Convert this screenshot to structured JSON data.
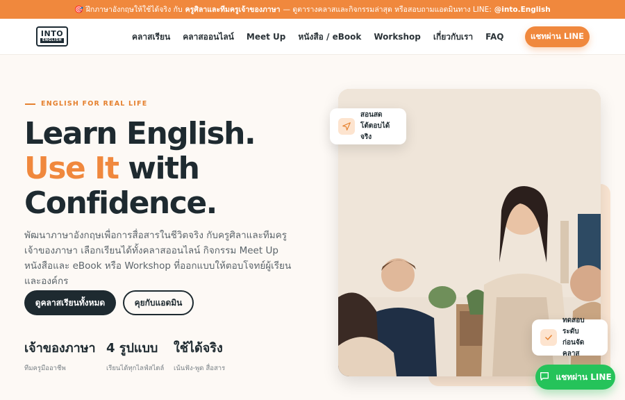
{
  "announcement": {
    "pre": "🎯 ฝึกภาษาอังกฤษให้ใช้ได้จริง กับ",
    "strong": "ครูศิลาและทีมครูเจ้าของภาษา",
    "mid": " — ดูตารางคลาสและกิจกรรมล่าสุด หรือสอบถามแอดมินทาง LINE:",
    "line_id": "@into.English"
  },
  "nav": {
    "logo_top": "INTO",
    "logo_bottom": "ENGLISH",
    "items": [
      "คลาสเรียน",
      "คลาสออนไลน์",
      "Meet Up",
      "หนังสือ / eBook",
      "Workshop",
      "เกี่ยวกับเรา",
      "FAQ"
    ],
    "cta": "แชทผ่าน LINE"
  },
  "hero": {
    "eyebrow": "ENGLISH FOR REAL LIFE",
    "title_line1": "Learn English.",
    "title_accent": "Use It",
    "title_line2_rest": " with",
    "title_line3": "Confidence.",
    "description": "พัฒนาภาษาอังกฤษเพื่อการสื่อสารในชีวิตจริง กับครูศิลาและทีมครูเจ้าของภาษา เลือกเรียนได้ทั้งคลาสออนไลน์ กิจกรรม Meet Up หนังสือและ eBook หรือ Workshop ที่ออกแบบให้ตอบโจทย์ผู้เรียนและองค์กร",
    "btn_primary": "ดูคลาสเรียนทั้งหมด",
    "btn_secondary": "คุยกับแอดมิน"
  },
  "stats": [
    {
      "value": "เจ้าของภาษา",
      "caption": "ทีมครูมืออาชีพ"
    },
    {
      "value": "4 รูปแบบ",
      "caption": "เรียนได้ทุกไลฟ์สไตล์"
    },
    {
      "value": "ใช้ได้จริง",
      "caption": "เน้นฟัง-พูด สื่อสาร"
    }
  ],
  "badges": {
    "top": {
      "line1": "สอนสด",
      "line2": "โต้ตอบได้จริง",
      "icon": "send-icon"
    },
    "bottom": {
      "line1": "ทดสอบระดับ",
      "line2": "ก่อนจัดคลาส",
      "icon": "check-icon"
    }
  },
  "floating_line": "แชทผ่าน LINE",
  "colors": {
    "accent": "#f0883d",
    "dark": "#1e2a30",
    "line_green": "#25c35a"
  }
}
